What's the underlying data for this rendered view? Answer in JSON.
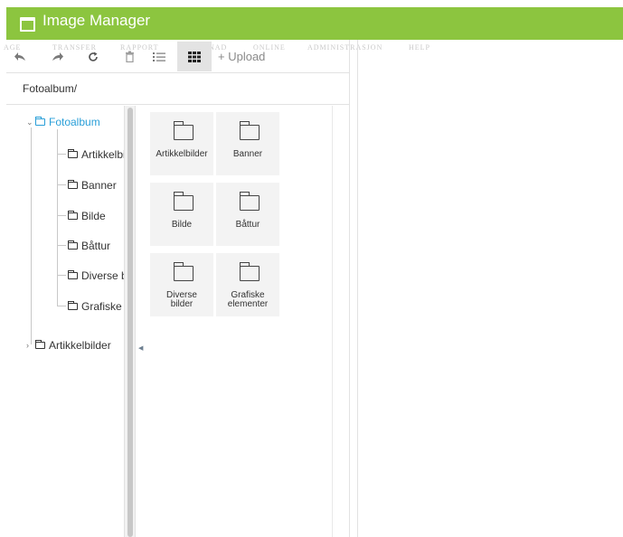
{
  "window": {
    "title": "Image Manager"
  },
  "ghost_menu": [
    "AGE",
    "TRANSFER",
    "RAPPORT",
    "MARKNAD",
    "ONLINE",
    "ADMINISTRASJON",
    "HELP"
  ],
  "toolbar": {
    "back_icon": "back-arrow",
    "forward_icon": "forward-arrow",
    "refresh_icon": "refresh",
    "delete_icon": "trash",
    "list_view_icon": "list",
    "grid_view_icon": "grid",
    "upload_label": "+ Upload"
  },
  "path": "Fotoalbum/",
  "tree": {
    "root": {
      "label": "Fotoalbum",
      "expanded": true,
      "color": "#2a9fd8"
    },
    "children": [
      "Artikkelbilder",
      "Banner",
      "Bilde",
      "Båttur",
      "Diverse bilder",
      "Grafiske elementer"
    ],
    "sibling": {
      "label": "Artikkelbilder",
      "expanded": false
    }
  },
  "folders": [
    {
      "name": "Artikkelbilder"
    },
    {
      "name": "Banner"
    },
    {
      "name": "Bilde"
    },
    {
      "name": "Båttur"
    },
    {
      "name": "Diverse bilder"
    },
    {
      "name": "Grafiske elementer"
    }
  ],
  "colors": {
    "titlebar": "#8cc53f",
    "active_tree": "#2a9fd8"
  }
}
